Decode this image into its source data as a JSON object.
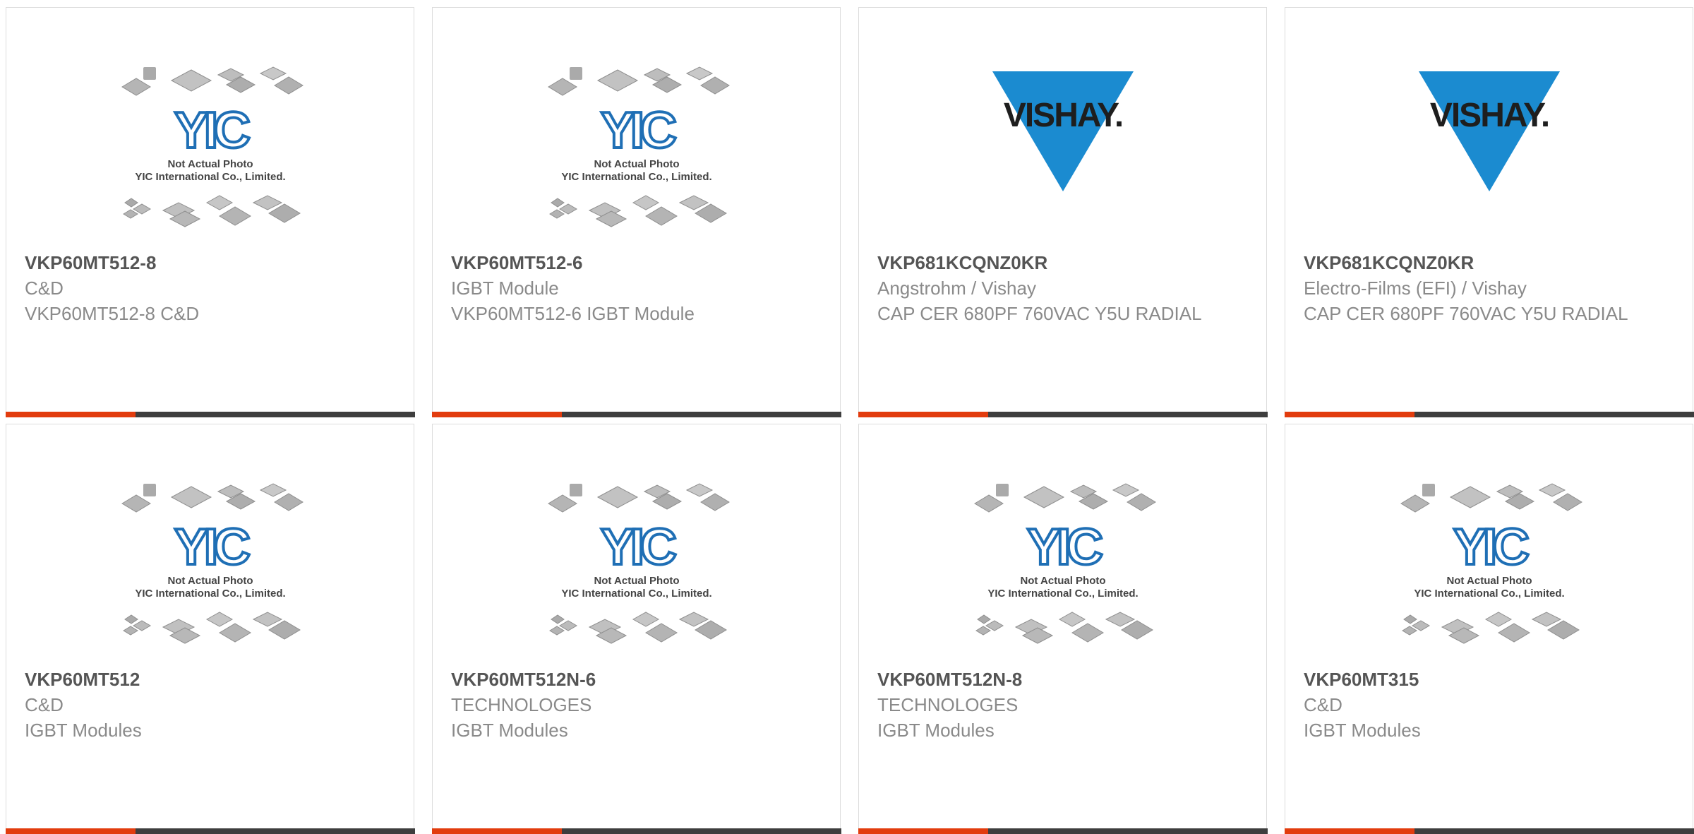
{
  "colors": {
    "accent": "#e23c0e",
    "bar": "#3e3e3e",
    "yic_blue": "#1f6fb5",
    "vishay_blue": "#1b8bd0"
  },
  "placeholder": {
    "line1": "Not Actual Photo",
    "line2": "YIC International Co., Limited.",
    "logo_text": "YIC"
  },
  "vishay": {
    "logo_text": "VISHAY."
  },
  "products": [
    {
      "part": "VKP60MT512-8",
      "manufacturer": "C&D",
      "description": "VKP60MT512-8 C&D",
      "image": "yic-placeholder"
    },
    {
      "part": "VKP60MT512-6",
      "manufacturer": "IGBT Module",
      "description": "VKP60MT512-6 IGBT Module",
      "image": "yic-placeholder"
    },
    {
      "part": "VKP681KCQNZ0KR",
      "manufacturer": "Angstrohm / Vishay",
      "description": "CAP CER 680PF 760VAC Y5U RADIAL",
      "image": "vishay-logo"
    },
    {
      "part": "VKP681KCQNZ0KR",
      "manufacturer": "Electro-Films (EFI) / Vishay",
      "description": "CAP CER 680PF 760VAC Y5U RADIAL",
      "image": "vishay-logo"
    },
    {
      "part": "VKP60MT512",
      "manufacturer": "C&D",
      "description": "IGBT Modules",
      "image": "yic-placeholder"
    },
    {
      "part": "VKP60MT512N-6",
      "manufacturer": "TECHNOLOGES",
      "description": "IGBT Modules",
      "image": "yic-placeholder"
    },
    {
      "part": "VKP60MT512N-8",
      "manufacturer": "TECHNOLOGES",
      "description": "IGBT Modules",
      "image": "yic-placeholder"
    },
    {
      "part": "VKP60MT315",
      "manufacturer": "C&D",
      "description": "IGBT Modules",
      "image": "yic-placeholder"
    }
  ]
}
